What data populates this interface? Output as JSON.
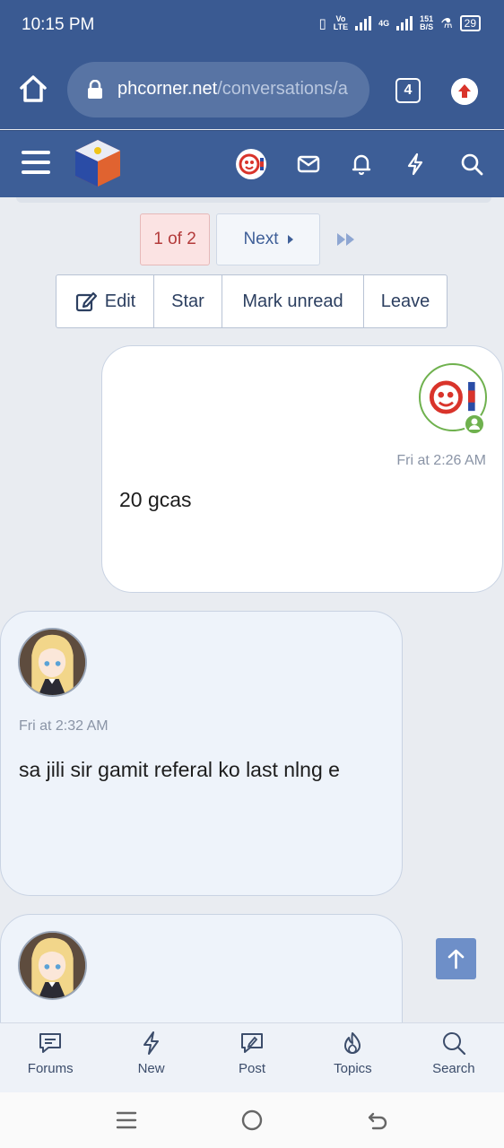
{
  "status_bar": {
    "time": "10:15 PM",
    "volte_top": "Vo",
    "volte_bottom": "LTE",
    "network": "4G",
    "speed_top": "151",
    "speed_bottom": "B/S",
    "battery": "29"
  },
  "browser": {
    "url_domain": "phcorner.net",
    "url_path": "/conversations/a",
    "tab_count": "4"
  },
  "pagination": {
    "current": "1 of 2",
    "next_label": "Next"
  },
  "actions": {
    "edit": "Edit",
    "star": "Star",
    "mark_unread": "Mark unread",
    "leave": "Leave"
  },
  "messages": [
    {
      "time": "Fri at 2:26 AM",
      "text": "20 gcas",
      "own": true
    },
    {
      "time": "Fri at 2:32 AM",
      "text": "sa jili sir gamit referal ko last nlng e",
      "own": false
    },
    {
      "time": "",
      "text": "",
      "own": false
    }
  ],
  "bottom_nav": [
    {
      "label": "Forums",
      "icon": "forums-icon"
    },
    {
      "label": "New",
      "icon": "lightning-icon"
    },
    {
      "label": "Post",
      "icon": "post-icon"
    },
    {
      "label": "Topics",
      "icon": "fire-icon"
    },
    {
      "label": "Search",
      "icon": "search-icon"
    }
  ],
  "colors": {
    "header_bg": "#3a5a92",
    "page_bg": "#e9ecf1",
    "online_green": "#6fb14e",
    "pager_current": "#b33a3a"
  }
}
